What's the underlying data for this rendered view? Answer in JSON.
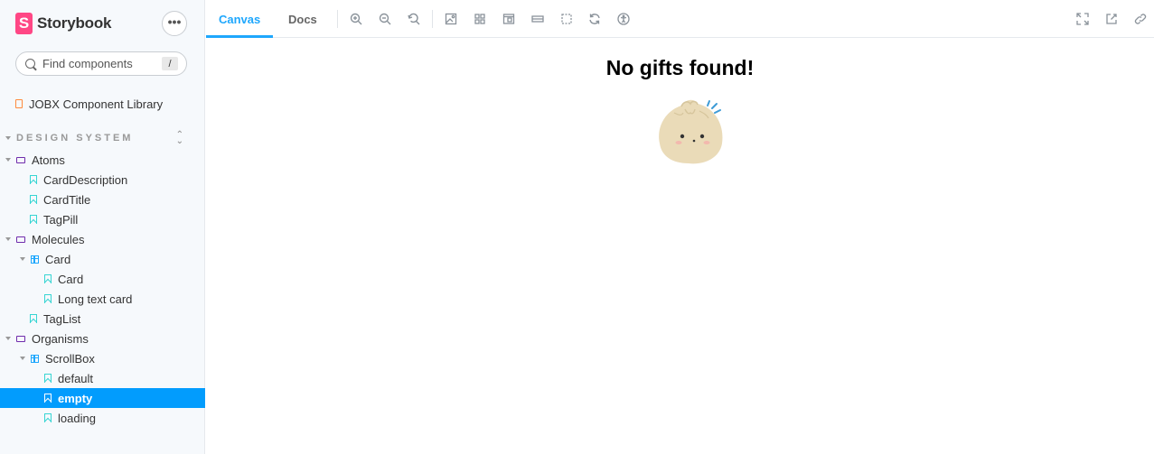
{
  "sidebar": {
    "brand": "Storybook",
    "brand_logo_letter": "S",
    "menu_label": "•••",
    "search": {
      "placeholder": "Find components",
      "shortcut": "/"
    },
    "top_item": {
      "label": "JOBX Component Library"
    },
    "section": {
      "title": "DESIGN SYSTEM"
    },
    "items": [
      {
        "label": "Atoms"
      },
      {
        "label": "CardDescription"
      },
      {
        "label": "CardTitle"
      },
      {
        "label": "TagPill"
      },
      {
        "label": "Molecules"
      },
      {
        "label": "Card"
      },
      {
        "label": "Card"
      },
      {
        "label": "Long text card"
      },
      {
        "label": "TagList"
      },
      {
        "label": "Organisms"
      },
      {
        "label": "ScrollBox"
      },
      {
        "label": "default"
      },
      {
        "label": "empty"
      },
      {
        "label": "loading"
      }
    ],
    "selected_item": "empty"
  },
  "toolbar": {
    "tabs": [
      {
        "label": "Canvas"
      },
      {
        "label": "Docs"
      }
    ],
    "active_tab": "Canvas",
    "tools": [
      "zoom-in-icon",
      "zoom-out-icon",
      "zoom-reset-icon",
      "background-icon",
      "grid-icon",
      "viewport-icon",
      "measure-icon",
      "outline-icon",
      "remount-icon",
      "accessibility-icon"
    ],
    "right_tools": [
      "fullscreen-icon",
      "open-new-tab-icon",
      "copy-link-icon"
    ]
  },
  "canvas": {
    "message": "No gifts found!",
    "illustration": "dumpling-illustration"
  },
  "colors": {
    "accent": "#1ea7fd",
    "selected": "#029cfd",
    "brand": "#ff4785"
  }
}
